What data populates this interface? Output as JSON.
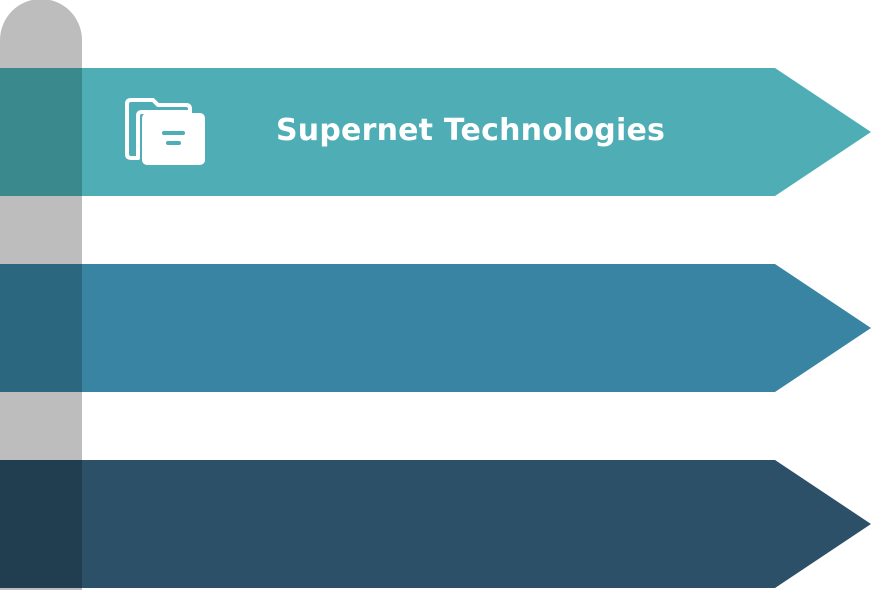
{
  "diagram": {
    "colors": {
      "pole": "#bdbdbd",
      "banner_1": "#4eadb5",
      "banner_1_shade": "#3a8a8d",
      "banner_2": "#3a84a3",
      "banner_2_shade": "#2c6780",
      "banner_3": "#2d5069",
      "banner_3_shade": "#213d50",
      "icon": "#ffffff"
    },
    "banners": [
      {
        "label": "Supernet Technologies",
        "icon": "folder-icon"
      },
      {
        "label": "",
        "icon": ""
      },
      {
        "label": "",
        "icon": ""
      }
    ]
  }
}
